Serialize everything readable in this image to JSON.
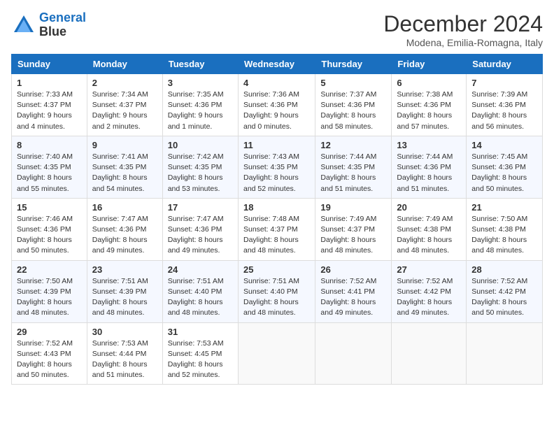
{
  "header": {
    "logo_line1": "General",
    "logo_line2": "Blue",
    "month_title": "December 2024",
    "subtitle": "Modena, Emilia-Romagna, Italy"
  },
  "days_of_week": [
    "Sunday",
    "Monday",
    "Tuesday",
    "Wednesday",
    "Thursday",
    "Friday",
    "Saturday"
  ],
  "weeks": [
    [
      {
        "day": "1",
        "sunrise": "Sunrise: 7:33 AM",
        "sunset": "Sunset: 4:37 PM",
        "daylight": "Daylight: 9 hours and 4 minutes."
      },
      {
        "day": "2",
        "sunrise": "Sunrise: 7:34 AM",
        "sunset": "Sunset: 4:37 PM",
        "daylight": "Daylight: 9 hours and 2 minutes."
      },
      {
        "day": "3",
        "sunrise": "Sunrise: 7:35 AM",
        "sunset": "Sunset: 4:36 PM",
        "daylight": "Daylight: 9 hours and 1 minute."
      },
      {
        "day": "4",
        "sunrise": "Sunrise: 7:36 AM",
        "sunset": "Sunset: 4:36 PM",
        "daylight": "Daylight: 9 hours and 0 minutes."
      },
      {
        "day": "5",
        "sunrise": "Sunrise: 7:37 AM",
        "sunset": "Sunset: 4:36 PM",
        "daylight": "Daylight: 8 hours and 58 minutes."
      },
      {
        "day": "6",
        "sunrise": "Sunrise: 7:38 AM",
        "sunset": "Sunset: 4:36 PM",
        "daylight": "Daylight: 8 hours and 57 minutes."
      },
      {
        "day": "7",
        "sunrise": "Sunrise: 7:39 AM",
        "sunset": "Sunset: 4:36 PM",
        "daylight": "Daylight: 8 hours and 56 minutes."
      }
    ],
    [
      {
        "day": "8",
        "sunrise": "Sunrise: 7:40 AM",
        "sunset": "Sunset: 4:35 PM",
        "daylight": "Daylight: 8 hours and 55 minutes."
      },
      {
        "day": "9",
        "sunrise": "Sunrise: 7:41 AM",
        "sunset": "Sunset: 4:35 PM",
        "daylight": "Daylight: 8 hours and 54 minutes."
      },
      {
        "day": "10",
        "sunrise": "Sunrise: 7:42 AM",
        "sunset": "Sunset: 4:35 PM",
        "daylight": "Daylight: 8 hours and 53 minutes."
      },
      {
        "day": "11",
        "sunrise": "Sunrise: 7:43 AM",
        "sunset": "Sunset: 4:35 PM",
        "daylight": "Daylight: 8 hours and 52 minutes."
      },
      {
        "day": "12",
        "sunrise": "Sunrise: 7:44 AM",
        "sunset": "Sunset: 4:35 PM",
        "daylight": "Daylight: 8 hours and 51 minutes."
      },
      {
        "day": "13",
        "sunrise": "Sunrise: 7:44 AM",
        "sunset": "Sunset: 4:36 PM",
        "daylight": "Daylight: 8 hours and 51 minutes."
      },
      {
        "day": "14",
        "sunrise": "Sunrise: 7:45 AM",
        "sunset": "Sunset: 4:36 PM",
        "daylight": "Daylight: 8 hours and 50 minutes."
      }
    ],
    [
      {
        "day": "15",
        "sunrise": "Sunrise: 7:46 AM",
        "sunset": "Sunset: 4:36 PM",
        "daylight": "Daylight: 8 hours and 50 minutes."
      },
      {
        "day": "16",
        "sunrise": "Sunrise: 7:47 AM",
        "sunset": "Sunset: 4:36 PM",
        "daylight": "Daylight: 8 hours and 49 minutes."
      },
      {
        "day": "17",
        "sunrise": "Sunrise: 7:47 AM",
        "sunset": "Sunset: 4:36 PM",
        "daylight": "Daylight: 8 hours and 49 minutes."
      },
      {
        "day": "18",
        "sunrise": "Sunrise: 7:48 AM",
        "sunset": "Sunset: 4:37 PM",
        "daylight": "Daylight: 8 hours and 48 minutes."
      },
      {
        "day": "19",
        "sunrise": "Sunrise: 7:49 AM",
        "sunset": "Sunset: 4:37 PM",
        "daylight": "Daylight: 8 hours and 48 minutes."
      },
      {
        "day": "20",
        "sunrise": "Sunrise: 7:49 AM",
        "sunset": "Sunset: 4:38 PM",
        "daylight": "Daylight: 8 hours and 48 minutes."
      },
      {
        "day": "21",
        "sunrise": "Sunrise: 7:50 AM",
        "sunset": "Sunset: 4:38 PM",
        "daylight": "Daylight: 8 hours and 48 minutes."
      }
    ],
    [
      {
        "day": "22",
        "sunrise": "Sunrise: 7:50 AM",
        "sunset": "Sunset: 4:39 PM",
        "daylight": "Daylight: 8 hours and 48 minutes."
      },
      {
        "day": "23",
        "sunrise": "Sunrise: 7:51 AM",
        "sunset": "Sunset: 4:39 PM",
        "daylight": "Daylight: 8 hours and 48 minutes."
      },
      {
        "day": "24",
        "sunrise": "Sunrise: 7:51 AM",
        "sunset": "Sunset: 4:40 PM",
        "daylight": "Daylight: 8 hours and 48 minutes."
      },
      {
        "day": "25",
        "sunrise": "Sunrise: 7:51 AM",
        "sunset": "Sunset: 4:40 PM",
        "daylight": "Daylight: 8 hours and 48 minutes."
      },
      {
        "day": "26",
        "sunrise": "Sunrise: 7:52 AM",
        "sunset": "Sunset: 4:41 PM",
        "daylight": "Daylight: 8 hours and 49 minutes."
      },
      {
        "day": "27",
        "sunrise": "Sunrise: 7:52 AM",
        "sunset": "Sunset: 4:42 PM",
        "daylight": "Daylight: 8 hours and 49 minutes."
      },
      {
        "day": "28",
        "sunrise": "Sunrise: 7:52 AM",
        "sunset": "Sunset: 4:42 PM",
        "daylight": "Daylight: 8 hours and 50 minutes."
      }
    ],
    [
      {
        "day": "29",
        "sunrise": "Sunrise: 7:52 AM",
        "sunset": "Sunset: 4:43 PM",
        "daylight": "Daylight: 8 hours and 50 minutes."
      },
      {
        "day": "30",
        "sunrise": "Sunrise: 7:53 AM",
        "sunset": "Sunset: 4:44 PM",
        "daylight": "Daylight: 8 hours and 51 minutes."
      },
      {
        "day": "31",
        "sunrise": "Sunrise: 7:53 AM",
        "sunset": "Sunset: 4:45 PM",
        "daylight": "Daylight: 8 hours and 52 minutes."
      },
      null,
      null,
      null,
      null
    ]
  ]
}
